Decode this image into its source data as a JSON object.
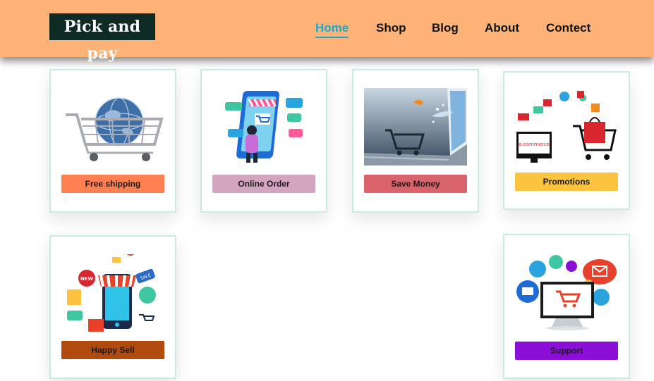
{
  "brand": {
    "name": "Pick and pay"
  },
  "nav": {
    "active": "Home",
    "items": [
      "Home",
      "Shop",
      "Blog",
      "About",
      "Contect"
    ]
  },
  "cards": [
    {
      "label": "Free shipping",
      "color": "#fe7f52",
      "icon": "shopping-cart-globe-icon"
    },
    {
      "label": "Online Order",
      "color": "#d4a5c1",
      "icon": "mobile-store-icon"
    },
    {
      "label": "Save Money",
      "color": "#d9646b",
      "icon": "laptop-cart-icon"
    },
    {
      "label": "Promotions",
      "color": "#fdc33e",
      "icon": "ecommerce-icon"
    },
    {
      "label": "Happy Sell",
      "color": "#b04a0e",
      "icon": "mobile-shop-icon"
    },
    {
      "label": "Support",
      "color": "#8c0fd7",
      "icon": "monitor-support-icon"
    }
  ],
  "colors": {
    "header": "#fdb377",
    "accent": "#1ba8c9",
    "card_border": "#c8ece0"
  }
}
